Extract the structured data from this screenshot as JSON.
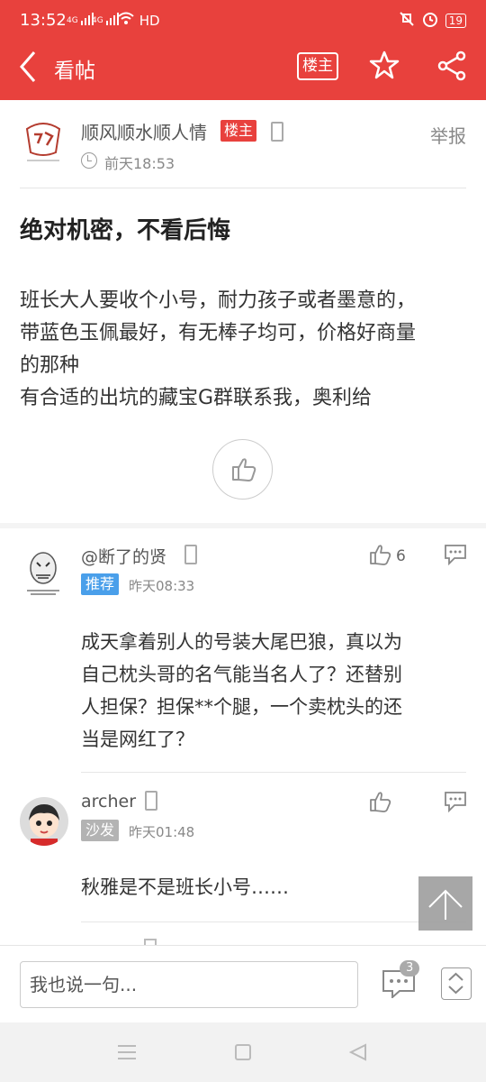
{
  "status": {
    "time": "13:52",
    "sig1": "4G",
    "sig2": "4G",
    "hd": "HD",
    "battery": "19"
  },
  "nav": {
    "title": "看帖",
    "louzhu_btn": "楼主"
  },
  "post": {
    "author": "顺风顺水顺人情",
    "author_tag": "楼主",
    "report": "举报",
    "time": "前天18:53",
    "title": "绝对机密，不看后悔",
    "body": "班长大人要收个小号，耐力孩子或者墨意的，\n带蓝色玉佩最好，有无棒子均可，价格好商量\n的那种\n有合适的出坑的藏宝G群联系我，奥利给"
  },
  "comments": [
    {
      "name": "@断了的贤",
      "badge": "推荐",
      "badge_color": "#4a9fea",
      "time": "昨天08:33",
      "likes": "6",
      "text": "成天拿着别人的号装大尾巴狼，真以为\n自己枕头哥的名气能当名人了？还替别\n人担保？担保**个腿，一个卖枕头的还\n当是网红了？"
    },
    {
      "name": "archer",
      "badge": "沙发",
      "badge_color": "#b3b3b3",
      "time": "昨天01:48",
      "likes": "",
      "text": "秋雅是不是班长小号……"
    }
  ],
  "bottom": {
    "placeholder": "我也说一句...",
    "comment_count": "3"
  },
  "colors": {
    "accent": "#e8413d"
  }
}
